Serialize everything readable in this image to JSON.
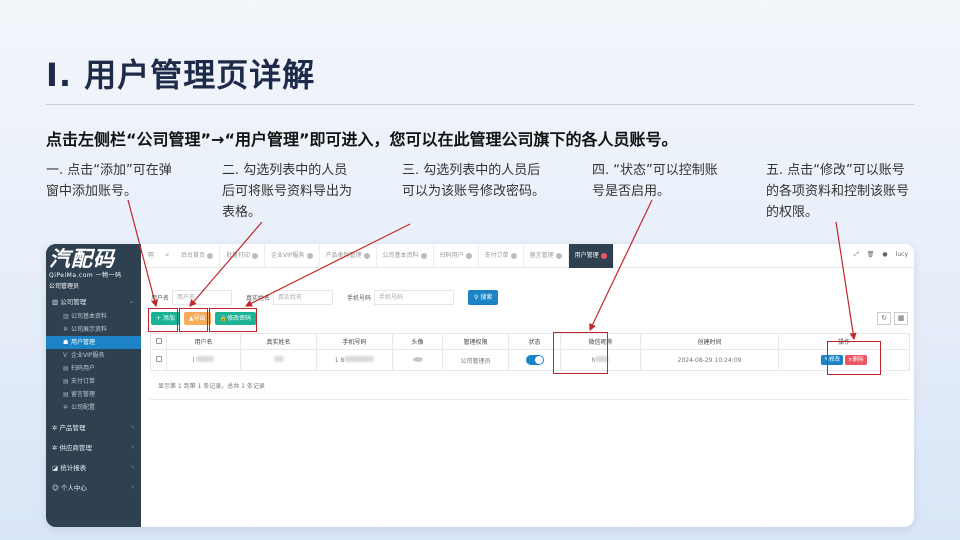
{
  "slide": {
    "title": "I. 用户管理页详解",
    "subtitle": "点击左侧栏“公司管理”→“用户管理”即可进入，您可以在此管理公司旗下的各人员账号。",
    "notes": [
      "一. 点击“添加”可在弹窗中添加账号。",
      "二. 勾选列表中的人员后可将账号资料导出为表格。",
      "三. 勾选列表中的人员后可以为该账号修改密码。",
      "四. “状态”可以控制账号是否启用。",
      "五. 点击“修改”可以账号的各项资料和控制该账号的权限。"
    ]
  },
  "app": {
    "logo": {
      "main": "汽配码",
      "sub": "QiPeiMa.com  一物一码",
      "role": "公司管理员"
    },
    "sidebar": {
      "groups": [
        {
          "label": "公司管理",
          "icon": "bank-icon",
          "expanded": true,
          "items": [
            {
              "label": "公司基本资料",
              "icon": "bank-icon",
              "active": false
            },
            {
              "label": "公司展示资料",
              "icon": "gear-icon",
              "active": false
            },
            {
              "label": "用户管理",
              "icon": "users-icon",
              "active": true
            },
            {
              "label": "企业VIP服务",
              "icon": "vip-icon",
              "active": false
            },
            {
              "label": "扫码用户",
              "icon": "list-icon",
              "active": false
            },
            {
              "label": "支付订单",
              "icon": "list-icon",
              "active": false
            },
            {
              "label": "留言管理",
              "icon": "list-icon",
              "active": false
            },
            {
              "label": "公司配置",
              "icon": "gear-icon",
              "active": false
            }
          ]
        },
        {
          "label": "产品管理",
          "icon": "gear-icon"
        },
        {
          "label": "供应商管理",
          "icon": "gear-icon"
        },
        {
          "label": "统计报表",
          "icon": "chart-icon"
        },
        {
          "label": "个人中心",
          "icon": "user-icon"
        }
      ]
    },
    "tabs": [
      "后台首页",
      "批量打印",
      "企业VIP服务",
      "产品类别管理",
      "公司基本资料",
      "扫码用户",
      "支付订单",
      "留言管理",
      "用户管理"
    ],
    "active_tab": "用户管理",
    "top_right": {
      "user": "lucy"
    },
    "filters": {
      "username": {
        "label": "用户名",
        "placeholder": "用户名"
      },
      "realname": {
        "label": "真实姓名",
        "placeholder": "真实姓名"
      },
      "phone": {
        "label": "手机号码",
        "placeholder": "手机号码"
      },
      "search": "搜索"
    },
    "actions": {
      "add": "+ 添加",
      "export": "导出",
      "change_pwd": "修改密码"
    },
    "table": {
      "headers": [
        "用户名",
        "真实姓名",
        "手机号码",
        "头像",
        "管理权限",
        "状态",
        "微信昵称",
        "创建时间",
        "操作"
      ],
      "rows": [
        {
          "username": "l",
          "realname": "",
          "phone": "1 8",
          "role": "公司管理员",
          "status": "on",
          "wechat": "h",
          "created": "2024-08-29 10:24:09",
          "edit": "修改",
          "delete": "删除"
        }
      ],
      "footer": "显示第 1 到第 1 条记录，总共 1 条记录"
    }
  },
  "colors": {
    "annotation": "#c0272d",
    "primary": "#1c84c6",
    "sidebar": "#2f4050",
    "add": "#1ab394",
    "export": "#f8ac59",
    "delete": "#ed5565"
  }
}
